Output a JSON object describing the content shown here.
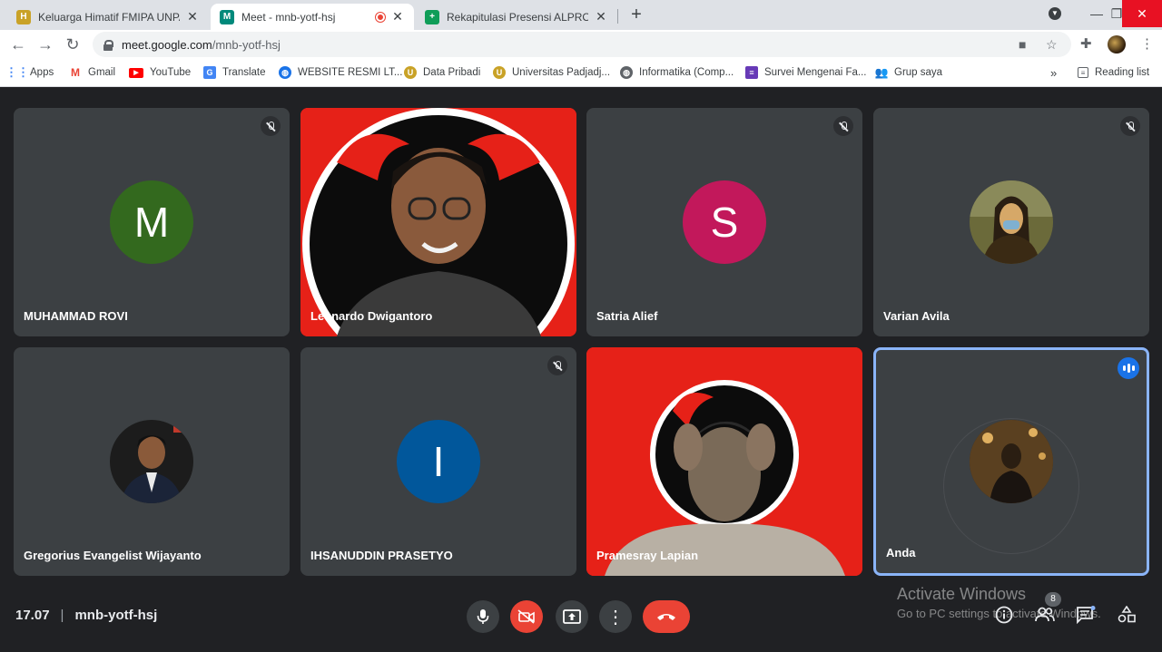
{
  "browser": {
    "tabs": [
      {
        "title": "Keluarga Himatif FMIPA UNPAD",
        "favicon_color": "#c9a227",
        "favicon_letter": "H"
      },
      {
        "title": "Meet - mnb-yotf-hsj",
        "favicon_color": "#00897b",
        "favicon_letter": "M"
      },
      {
        "title": "Rekapitulasi Presensi ALPRO (B)",
        "favicon_color": "#0f9d58",
        "favicon_letter": "+"
      }
    ],
    "new_tab_label": "+",
    "url_host": "meet.google.com",
    "url_path": "/mnb-yotf-hsj",
    "bookmarks": [
      {
        "label": "Apps",
        "icon": "apps-grid-icon",
        "color": "#4285f4"
      },
      {
        "label": "Gmail",
        "icon": "gmail-icon",
        "color": "#ea4335"
      },
      {
        "label": "YouTube",
        "icon": "youtube-icon",
        "color": "#ff0000"
      },
      {
        "label": "Translate",
        "icon": "translate-icon",
        "color": "#4285f4"
      },
      {
        "label": "WEBSITE RESMI LT...",
        "icon": "globe-icon",
        "color": "#1a73e8"
      },
      {
        "label": "Data Pribadi",
        "icon": "unpad-icon",
        "color": "#c9a227"
      },
      {
        "label": "Universitas Padjadj...",
        "icon": "unpad-icon",
        "color": "#c9a227"
      },
      {
        "label": "Informatika (Comp...",
        "icon": "globe-icon",
        "color": "#5f6368"
      },
      {
        "label": "Survei Mengenai Fa...",
        "icon": "forms-icon",
        "color": "#673ab7"
      },
      {
        "label": "Grup saya",
        "icon": "groups-icon",
        "color": "#4285f4"
      }
    ],
    "reading_list": "Reading list"
  },
  "meet": {
    "participants": [
      {
        "name": "MUHAMMAD ROVI",
        "avatar_letter": "M",
        "avatar_color": "#33691e",
        "muted": true
      },
      {
        "name": "Leonardo Dwigantoro",
        "video": true,
        "muted": false
      },
      {
        "name": "Satria Alief",
        "avatar_letter": "S",
        "avatar_color": "#c2185b",
        "muted": true
      },
      {
        "name": "Varian Avila",
        "photo": "mona-lisa",
        "muted": true
      },
      {
        "name": "Gregorius Evangelist Wijayanto",
        "photo": "person",
        "muted": false
      },
      {
        "name": "IHSANUDDIN PRASETYO",
        "avatar_letter": "I",
        "avatar_color": "#01579b",
        "muted": true
      },
      {
        "name": "Pramesray Lapian",
        "video": true,
        "muted": false
      },
      {
        "name": "Anda",
        "photo": "self",
        "speaking": true
      }
    ],
    "time": "17.07",
    "meeting_code": "mnb-yotf-hsj",
    "participant_count": "8",
    "watermark_title": "Activate Windows",
    "watermark_sub": "Go to PC settings to activate Windows."
  }
}
